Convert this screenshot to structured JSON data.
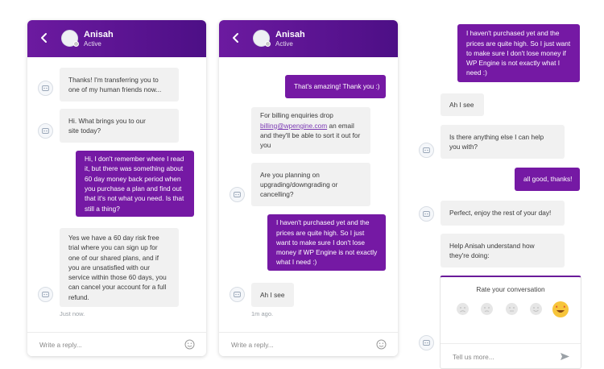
{
  "agent": {
    "name": "Anisah",
    "status": "Active"
  },
  "composer": {
    "placeholder": "Write a reply..."
  },
  "panel1": {
    "messages": [
      [
        "Thanks! I'm transferring you to",
        "one of my human friends now..."
      ],
      [
        "Hi. What brings you to our",
        "site today?"
      ],
      [
        "Hi, I don't remember where I read",
        "it, but there was something about",
        "60 day money back period when",
        "you purchase a plan and find out",
        "that it's not what you need. Is that",
        "still a thing?"
      ],
      [
        "Yes we have a 60 day risk free",
        "trial where you can sign up for",
        "one of our shared plans, and if",
        "you are unsatisfied with our",
        "service within those 60 days, you",
        "can cancel your account for a full",
        "refund."
      ]
    ],
    "timestamp": "Just now."
  },
  "panel2": {
    "messages": [
      [
        "That's amazing! Thank you :)"
      ],
      [
        "For billing enquiries drop",
        "billing@wpengine.com",
        "an email",
        "and they'll be able to sort it out for",
        "you"
      ],
      [
        "Are you planning on",
        "upgrading/downgrading or",
        "cancelling?"
      ],
      [
        "I haven't purchased yet and the",
        "prices are quite high. So I just",
        "want to make sure I don't lose",
        "money if WP Engine is not exactly",
        "what I need :)"
      ],
      [
        "Ah I see"
      ]
    ],
    "timestamp": "1m ago."
  },
  "panel3": {
    "messages": [
      [
        "I haven't purchased yet and the",
        "prices are quite high. So I just want",
        "to make sure I don't lose money if",
        "WP Engine is not exactly what I",
        "need :)"
      ],
      [
        "Ah I see"
      ],
      [
        "Is there anything else I can help",
        "you with?"
      ],
      [
        "all good, thanks!"
      ],
      [
        "Perfect, enjoy the rest of your day!"
      ],
      [
        "Help Anisah understand how",
        "they're doing:"
      ]
    ],
    "rating": {
      "title": "Rate your conversation",
      "placeholder": "Tell us more..."
    }
  },
  "colors": {
    "brand": "#6c1aa0",
    "user_bubble": "#7519a4",
    "bot_bubble": "#f1f1f1"
  },
  "icons": [
    "back-arrow-icon",
    "bot-avatar-icon",
    "emoji-icon",
    "rating-face-icon",
    "send-icon"
  ]
}
